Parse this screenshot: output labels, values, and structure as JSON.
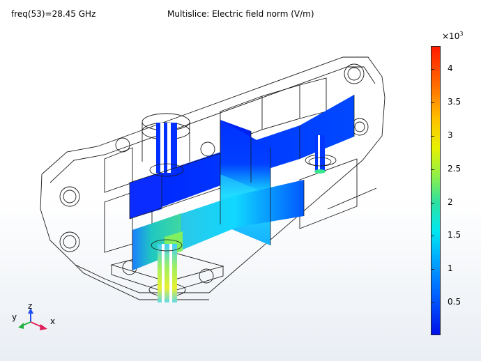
{
  "header": {
    "freq_label": "freq(53)=28.45 GHz",
    "plot_title": "Multislice: Electric field norm (V/m)"
  },
  "colorbar": {
    "exponent_prefix": "×10",
    "exponent_power": "3",
    "ticks": [
      "4",
      "3.5",
      "3",
      "2.5",
      "2",
      "1.5",
      "1",
      "0.5"
    ],
    "colors": [
      "#0010e8",
      "#0057ff",
      "#00a8ff",
      "#00e8f0",
      "#2ee0a0",
      "#8ef04a",
      "#e8f000",
      "#ffc000",
      "#ff7000",
      "#ff1a00"
    ]
  },
  "axes_triad": {
    "x": "x",
    "y": "y",
    "z": "z"
  }
}
